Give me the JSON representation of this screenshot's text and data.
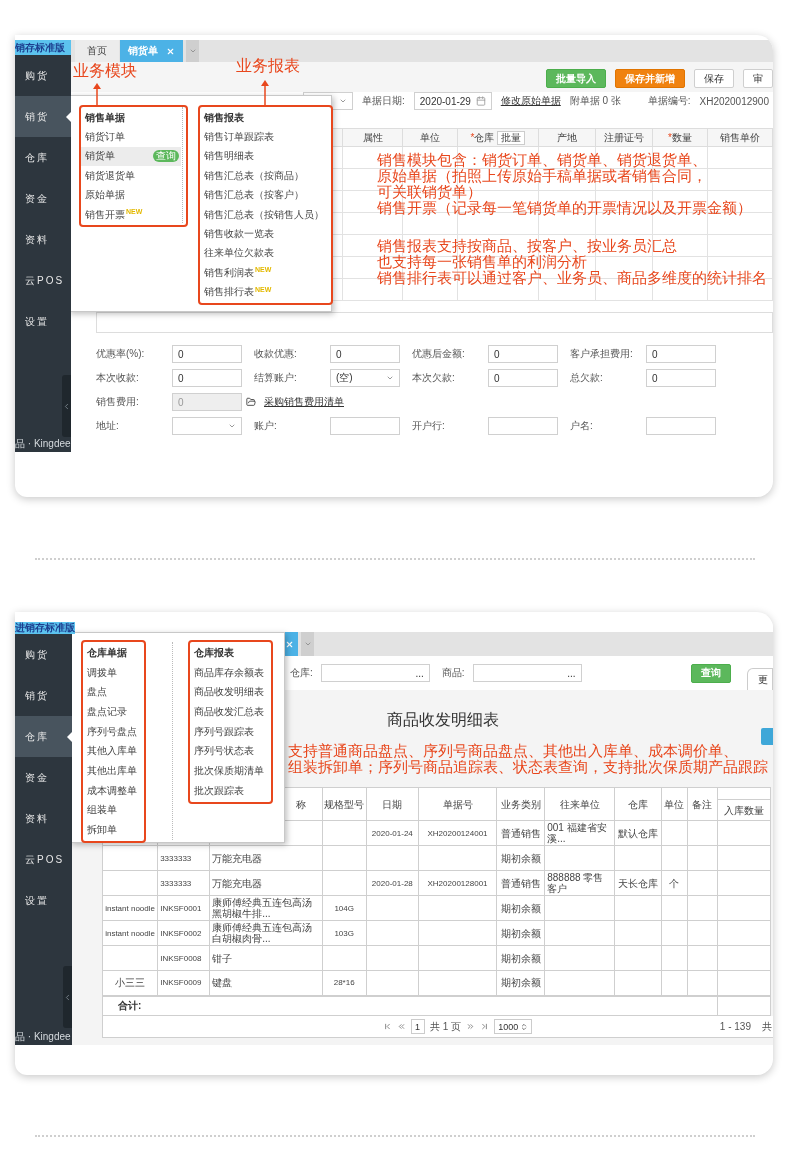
{
  "sales_screen": {
    "edition_label": "销存标准版",
    "sidebar": {
      "items": [
        {
          "label": "购货",
          "selected": false
        },
        {
          "label": "销货",
          "selected": true
        },
        {
          "label": "仓库",
          "selected": false
        },
        {
          "label": "资金",
          "selected": false
        },
        {
          "label": "资料",
          "selected": false
        },
        {
          "label": "云POS",
          "selected": false
        },
        {
          "label": "设置",
          "selected": false
        }
      ],
      "footer": "品 · Kingdee"
    },
    "tabs": [
      {
        "label": "首页",
        "selected": false,
        "closable": false
      },
      {
        "label": "销货单",
        "selected": true,
        "closable": true
      }
    ],
    "toolbar": [
      {
        "label": "批量导入",
        "kind": "success"
      },
      {
        "label": "保存并新增",
        "kind": "warning"
      },
      {
        "label": "保存",
        "kind": "default"
      },
      {
        "label": "审",
        "kind": "default"
      }
    ],
    "header_form": {
      "date_label": "单据日期:",
      "date_value": "2020-01-29",
      "edit_link": "修改原始单据",
      "attachments": "附单据 0 张",
      "number_label": "单据编号:",
      "number_value": "XH2020012900"
    },
    "table": {
      "columns": [
        {
          "label": "属性"
        },
        {
          "label": "单位"
        },
        {
          "label": "仓库",
          "mark": "*",
          "action": "批量"
        },
        {
          "label": "产地"
        },
        {
          "label": "注册证号"
        },
        {
          "label": "数量",
          "mark": "*"
        },
        {
          "label": "销售单价"
        }
      ]
    },
    "form_rows": [
      [
        {
          "label": "优惠率(%):",
          "kind": "input",
          "value": "0",
          "disabled": false
        },
        {
          "label": "收款优惠:",
          "kind": "input",
          "value": "0",
          "disabled": false
        },
        {
          "label": "优惠后金额:",
          "kind": "input",
          "value": "0",
          "disabled": false
        },
        {
          "label": "客户承担费用:",
          "kind": "input",
          "value": "0",
          "disabled": false
        }
      ],
      [
        {
          "label": "本次收款:",
          "kind": "input",
          "value": "0",
          "disabled": false
        },
        {
          "label": "结算账户:",
          "kind": "select",
          "value": "(空)",
          "disabled": false
        },
        {
          "label": "本次欠款:",
          "kind": "input",
          "value": "0",
          "disabled": false
        },
        {
          "label": "总欠款:",
          "kind": "input",
          "value": "0",
          "disabled": false
        }
      ],
      [
        {
          "label": "销售费用:",
          "kind": "input",
          "value": "0",
          "disabled": true
        },
        {
          "kind": "link",
          "text": "采购销售费用清单"
        }
      ],
      [
        {
          "label": "地址:",
          "kind": "select",
          "disabled": false
        },
        {
          "label": "账户:",
          "kind": "input",
          "disabled": false
        },
        {
          "label": "开户行:",
          "kind": "input",
          "disabled": false
        },
        {
          "label": "户名:",
          "kind": "input",
          "disabled": false
        }
      ]
    ],
    "menu": {
      "columns": [
        {
          "title": "销售单据",
          "items": [
            {
              "label": "销货订单",
              "selected": false
            },
            {
              "label": "销货单",
              "selected": true,
              "action": "查询"
            },
            {
              "label": "销货退货单",
              "selected": false
            },
            {
              "label": "原始单据",
              "selected": false
            },
            {
              "label": "销售开票",
              "selected": false,
              "badge": "NEW"
            }
          ]
        },
        {
          "title": "销售报表",
          "items": [
            {
              "label": "销售订单跟踪表",
              "selected": false
            },
            {
              "label": "销售明细表",
              "selected": false
            },
            {
              "label": "销售汇总表（按商品）",
              "selected": false
            },
            {
              "label": "销售汇总表（按客户）",
              "selected": false
            },
            {
              "label": "销售汇总表（按销售人员）",
              "selected": false
            },
            {
              "label": "销售收款一览表",
              "selected": false
            },
            {
              "label": "往来单位欠款表",
              "selected": false
            },
            {
              "label": "销售利润表",
              "selected": false,
              "badge": "NEW"
            },
            {
              "label": "销售排行表",
              "selected": false,
              "badge": "NEW"
            }
          ]
        }
      ]
    },
    "callouts": [
      {
        "text": "业务模块"
      },
      {
        "text": "业务报表"
      }
    ],
    "notes": [
      [
        "销售模块包含：销货订单、销货单、销货退货单、",
        "原始单据（拍照上传原始手稿单据或者销售合同，",
        "可关联销货单）",
        "销售开票（记录每一笔销货单的开票情况以及开票金额）"
      ],
      [
        "销售报表支持按商品、按客户、按业务员汇总",
        "也支持每一张销售单的利润分析",
        "销售排行表可以通过客户、业务员、商品多维度的统计排名"
      ]
    ]
  },
  "warehouse_screen": {
    "edition_label": "进销存标准版",
    "sidebar": {
      "items": [
        {
          "label": "购货",
          "selected": false
        },
        {
          "label": "销货",
          "selected": false
        },
        {
          "label": "仓库",
          "selected": true
        },
        {
          "label": "资金",
          "selected": false
        },
        {
          "label": "资料",
          "selected": false
        },
        {
          "label": "云POS",
          "selected": false
        },
        {
          "label": "设置",
          "selected": false
        }
      ],
      "footer": "品 · Kingdee"
    },
    "tabs": [
      {
        "selected": true,
        "closable": true
      }
    ],
    "filters": [
      {
        "label": "仓库:",
        "picker": "..."
      },
      {
        "label": "商品:",
        "picker": "..."
      }
    ],
    "query_button": "查询",
    "side_tab": "更",
    "report_title": "商品收发明细表",
    "notes": [
      [
        "支持普通商品盘点、序列号商品盘点、其他出入库单、成本调价单、",
        "组装拆卸单；序列号商品追踪表、状态表查询，支持批次保质期产品跟踪"
      ]
    ],
    "menu": {
      "columns": [
        {
          "title": "仓库单据",
          "items": [
            {
              "label": "调拨单",
              "selected": false
            },
            {
              "label": "盘点",
              "selected": false
            },
            {
              "label": "盘点记录",
              "selected": false
            },
            {
              "label": "序列号盘点",
              "selected": false
            },
            {
              "label": "其他入库单",
              "selected": false
            },
            {
              "label": "其他出库单",
              "selected": false
            },
            {
              "label": "成本调整单",
              "selected": false
            },
            {
              "label": "组装单",
              "selected": false
            },
            {
              "label": "拆卸单",
              "selected": false
            }
          ]
        },
        {
          "title": "仓库报表",
          "items": [
            {
              "label": "商品库存余额表",
              "selected": false
            },
            {
              "label": "商品收发明细表",
              "selected": false
            },
            {
              "label": "商品收发汇总表",
              "selected": false
            },
            {
              "label": "序列号跟踪表",
              "selected": false
            },
            {
              "label": "序列号状态表",
              "selected": false
            },
            {
              "label": "批次保质期清单",
              "selected": false
            },
            {
              "label": "批次跟踪表",
              "selected": false
            }
          ]
        }
      ]
    },
    "table": {
      "columns": [
        null,
        null,
        "称",
        "规格型号",
        "日期",
        "单据号",
        "业务类别",
        "往来单位",
        "仓库",
        "单位",
        "备注",
        "入库数量"
      ],
      "rows": [
        [
          null,
          null,
          null,
          null,
          "2020-01-24",
          "XH20200124001",
          "普通销售",
          "001 福建省安溪...",
          "默认仓库"
        ],
        [
          null,
          "3333333",
          "万能充电器",
          null,
          null,
          null,
          "期初余额"
        ],
        [
          null,
          "3333333",
          "万能充电器",
          null,
          "2020-01-28",
          "XH20200128001",
          "普通销售",
          "888888 零售客户",
          "天长仓库",
          "个"
        ],
        [
          "instant noodle",
          "INKSF0001",
          "康师傅经典五连包高汤黑胡椒牛排...",
          "104G",
          null,
          null,
          "期初余额"
        ],
        [
          "instant noodle",
          "INKSF0002",
          "康师傅经典五连包高汤白胡椒肉骨...",
          "103G",
          null,
          null,
          "期初余额"
        ],
        [
          null,
          "INKSF0008",
          "钳子",
          null,
          null,
          null,
          "期初余额"
        ],
        [
          "小三三",
          "INKSF0009",
          "键盘",
          "28*16",
          null,
          null,
          "期初余额"
        ]
      ],
      "total_label": "合计:"
    },
    "pagination": {
      "page": "1",
      "pages": "共 1 页",
      "page_size": "1000",
      "range": "1 - 139",
      "total": "共"
    }
  }
}
